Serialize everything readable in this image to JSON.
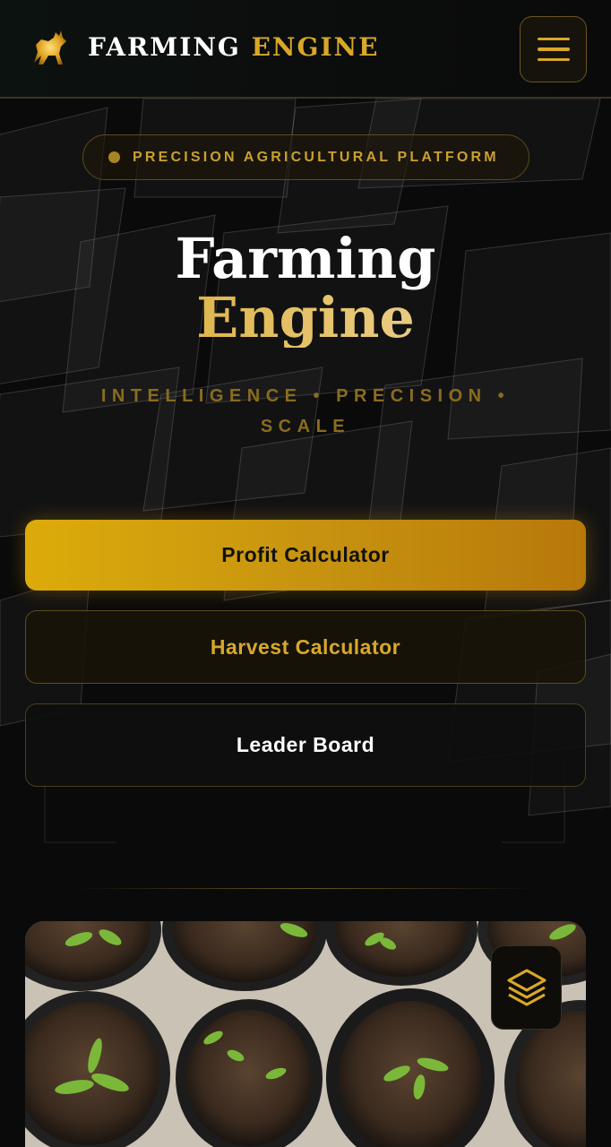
{
  "header": {
    "brand_word1": "FARMING",
    "brand_word2": "ENGINE",
    "logo_icon": "golden-bull-icon",
    "menu_icon": "hamburger-menu-icon"
  },
  "hero": {
    "badge_text": "PRECISION AGRICULTURAL PLATFORM",
    "title_line1": "Farming",
    "title_line2": "Engine",
    "tagline_line1": "INTELLIGENCE  •  PRECISION  •",
    "tagline_line2": "SCALE"
  },
  "actions": {
    "profit_calculator": "Profit Calculator",
    "harvest_calculator": "Harvest Calculator",
    "leader_board": "Leader Board"
  },
  "gallery": {
    "layers_icon": "layers-icon"
  },
  "colors": {
    "gold": "#d9a828",
    "background": "#0a0a0a"
  }
}
